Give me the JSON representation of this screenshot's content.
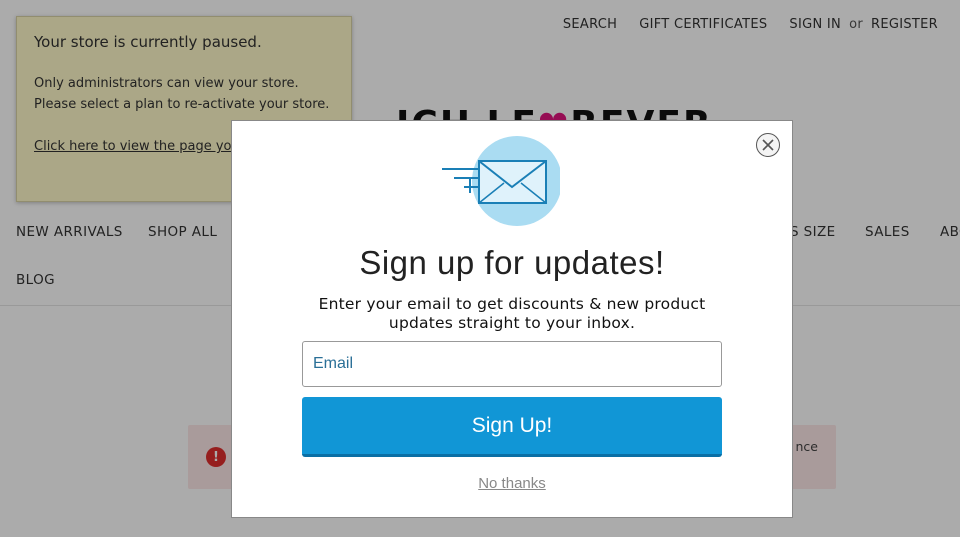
{
  "topnav": {
    "search": "SEARCH",
    "gift_certificates": "GIFT CERTIFICATES",
    "sign_in": "SIGN IN",
    "or": "or",
    "register": "REGISTER"
  },
  "paused_banner": {
    "title": "Your store is currently paused.",
    "line1": "Only administrators can view your store.",
    "line2": "Please select a plan to re-activate your store.",
    "link": "Click here to view the page you see."
  },
  "logo": {
    "text_left": "ICH LE",
    "text_right": "REVER"
  },
  "mainnav": {
    "new_arrivals": "NEW ARRIVALS",
    "shop_all": "SHOP ALL",
    "size_partial": "S SIZE",
    "sales": "SALES",
    "about_partial": "ABO",
    "blog": "BLOG"
  },
  "alert": {
    "icon": "!",
    "text_partial": "nce"
  },
  "modal": {
    "title": "Sign up for updates!",
    "subtitle": "Enter your email to get discounts & new product updates straight to your inbox.",
    "email_placeholder": "Email",
    "signup_label": "Sign Up!",
    "no_thanks": "No thanks",
    "icons": {
      "close": "close-icon",
      "envelope": "envelope-icon"
    },
    "colors": {
      "button": "#1196d6",
      "envelope_circle": "#aadcf2",
      "envelope_stroke": "#1a7fb6"
    }
  }
}
